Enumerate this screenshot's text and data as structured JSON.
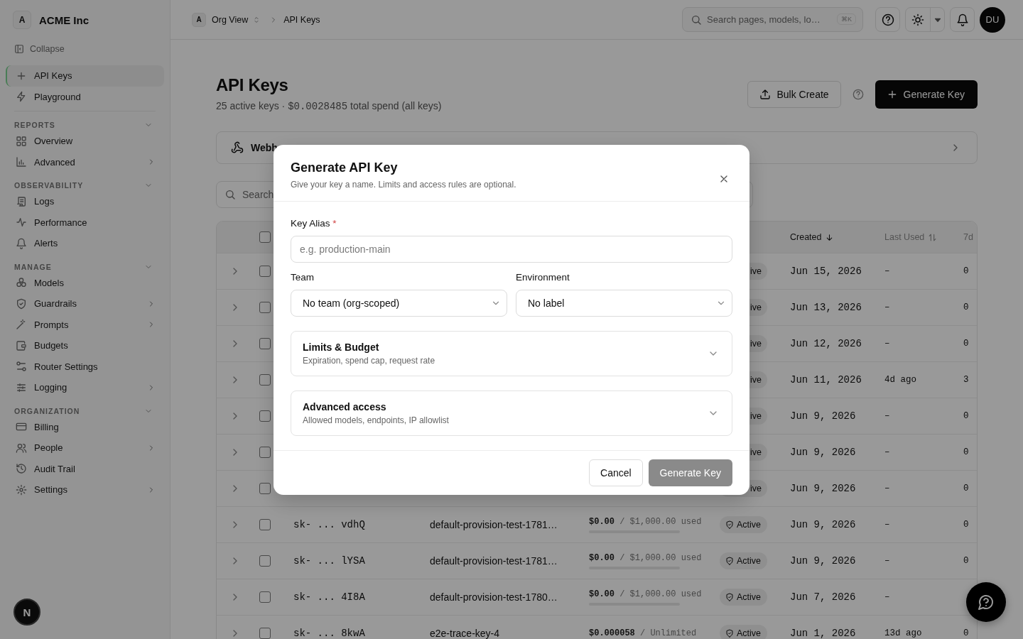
{
  "sidebar": {
    "org_initial": "A",
    "org_name": "ACME Inc",
    "collapse_label": "Collapse",
    "top_items": [
      {
        "label": "API Keys",
        "selected": true
      },
      {
        "label": "Playground",
        "selected": false
      }
    ],
    "sections": [
      {
        "title": "REPORTS",
        "expanded": true,
        "items": [
          {
            "label": "Overview",
            "kind": "link",
            "selected": false
          },
          {
            "label": "Advanced",
            "kind": "group",
            "selected": false
          }
        ]
      },
      {
        "title": "OBSERVABILITY",
        "expanded": true,
        "items": [
          {
            "label": "Logs",
            "kind": "link",
            "selected": false
          },
          {
            "label": "Performance",
            "kind": "link",
            "selected": false
          },
          {
            "label": "Alerts",
            "kind": "link",
            "selected": false
          }
        ]
      },
      {
        "title": "MANAGE",
        "expanded": true,
        "items": [
          {
            "label": "Models",
            "kind": "link",
            "selected": false
          },
          {
            "label": "Guardrails",
            "kind": "group",
            "selected": false
          },
          {
            "label": "Prompts",
            "kind": "group",
            "selected": false
          },
          {
            "label": "Budgets",
            "kind": "link",
            "selected": false
          },
          {
            "label": "Router Settings",
            "kind": "link",
            "selected": false
          },
          {
            "label": "Logging",
            "kind": "group",
            "selected": false
          }
        ]
      },
      {
        "title": "ORGANIZATION",
        "expanded": true,
        "items": [
          {
            "label": "Billing",
            "kind": "link",
            "selected": false
          },
          {
            "label": "People",
            "kind": "group",
            "selected": false
          },
          {
            "label": "Audit Trail",
            "kind": "link",
            "selected": false
          },
          {
            "label": "Settings",
            "kind": "group",
            "selected": false
          }
        ]
      }
    ]
  },
  "dev_badge": "N",
  "header": {
    "breadcrumb": {
      "org_initial": "A",
      "org": "Org View",
      "page": "API Keys"
    },
    "search": {
      "placeholder": "Search pages, models, lo…",
      "shortcut": "⌘K"
    },
    "avatar": "DU"
  },
  "page": {
    "title": "API Keys",
    "subtitle": {
      "before": "25 active keys ·",
      "amount": "$0.0028485",
      "after": "total spend (all keys)"
    },
    "actions": [
      {
        "label": "Bulk Create",
        "kind": "secondary"
      },
      {
        "label": "Generate Key",
        "kind": "primary"
      }
    ]
  },
  "webhooks": {
    "label": "Webh"
  },
  "table_search": {
    "placeholder": "Search"
  },
  "table": {
    "header_checked": false,
    "columns": [
      {
        "label": "Created",
        "sorted": true
      },
      {
        "label": "Last Used",
        "sorted": false
      },
      {
        "label": "7d"
      }
    ],
    "rows": [
      {
        "kind": "covered",
        "expanded": false,
        "checked": false,
        "status": "ive",
        "created": "Jun 15, 2026",
        "last_used": "–",
        "usage_7d": "0"
      },
      {
        "kind": "covered",
        "expanded": false,
        "checked": false,
        "status": "ive",
        "created": "Jun 13, 2026",
        "last_used": "–",
        "usage_7d": "0"
      },
      {
        "kind": "covered",
        "expanded": false,
        "checked": false,
        "status": "ive",
        "created": "Jun 12, 2026",
        "last_used": "–",
        "usage_7d": "0"
      },
      {
        "kind": "covered",
        "expanded": false,
        "checked": false,
        "status": "ive",
        "created": "Jun 11, 2026",
        "last_used": "4d ago",
        "usage_7d": "3"
      },
      {
        "kind": "covered",
        "expanded": false,
        "checked": false,
        "status": "ive",
        "created": "Jun 9, 2026",
        "last_used": "–",
        "usage_7d": "0"
      },
      {
        "kind": "covered",
        "expanded": false,
        "checked": false,
        "status": "ive",
        "created": "Jun 9, 2026",
        "last_used": "–",
        "usage_7d": "0"
      },
      {
        "kind": "covered",
        "expanded": false,
        "checked": false,
        "status": "ive",
        "created": "Jun 9, 2026",
        "last_used": "–",
        "usage_7d": "0"
      },
      {
        "kind": "full",
        "expanded": false,
        "checked": false,
        "key": "sk- ... vdhQ",
        "name": "default-provision-test-1781…",
        "spend": "**$0.00** / $1,000.00 used",
        "level": 0,
        "status": "Active",
        "created": "Jun 9, 2026",
        "last_used": "–",
        "usage_7d": "0"
      },
      {
        "kind": "full",
        "expanded": false,
        "checked": false,
        "key": "sk- ... lYSA",
        "name": "default-provision-test-1781…",
        "spend": "**$0.00** / $1,000.00 used",
        "level": 0,
        "status": "Active",
        "created": "Jun 9, 2026",
        "last_used": "–",
        "usage_7d": "0"
      },
      {
        "kind": "full",
        "expanded": false,
        "checked": false,
        "key": "sk- ... 4I8A",
        "name": "default-provision-test-1780…",
        "spend": "**$0.00** / $1,000.00 used",
        "level": 0,
        "status": "Active",
        "created": "Jun 7, 2026",
        "last_used": "–"
      },
      {
        "kind": "full",
        "expanded": false,
        "checked": false,
        "key": "sk- ... 8kwA",
        "name": "e2e-trace-key-4",
        "spend": "**$0.000058** / Unlimited",
        "status": "Active",
        "created": "Jun 1, 2026",
        "last_used": "13d ago",
        "usage_7d": "0"
      }
    ]
  },
  "modal": {
    "title": "Generate API Key",
    "description": "Give your key a name. Limits and access rules are optional.",
    "alias": {
      "label": "Key Alias",
      "required_mark": "*",
      "placeholder": "e.g. production-main"
    },
    "selects": [
      {
        "label": "Team",
        "value": "No team (org-scoped)"
      },
      {
        "label": "Environment",
        "value": "No label"
      }
    ],
    "sections": [
      {
        "title": "Limits & Budget",
        "subtitle": "Expiration, spend cap, request rate",
        "expanded": false
      },
      {
        "title": "Advanced access",
        "subtitle": "Allowed models, endpoints, IP allowlist",
        "expanded": false
      }
    ],
    "buttons": [
      {
        "label": "Cancel",
        "kind": "secondary",
        "disabled": false
      },
      {
        "label": "Generate Key",
        "kind": "primary",
        "disabled": true
      }
    ]
  }
}
